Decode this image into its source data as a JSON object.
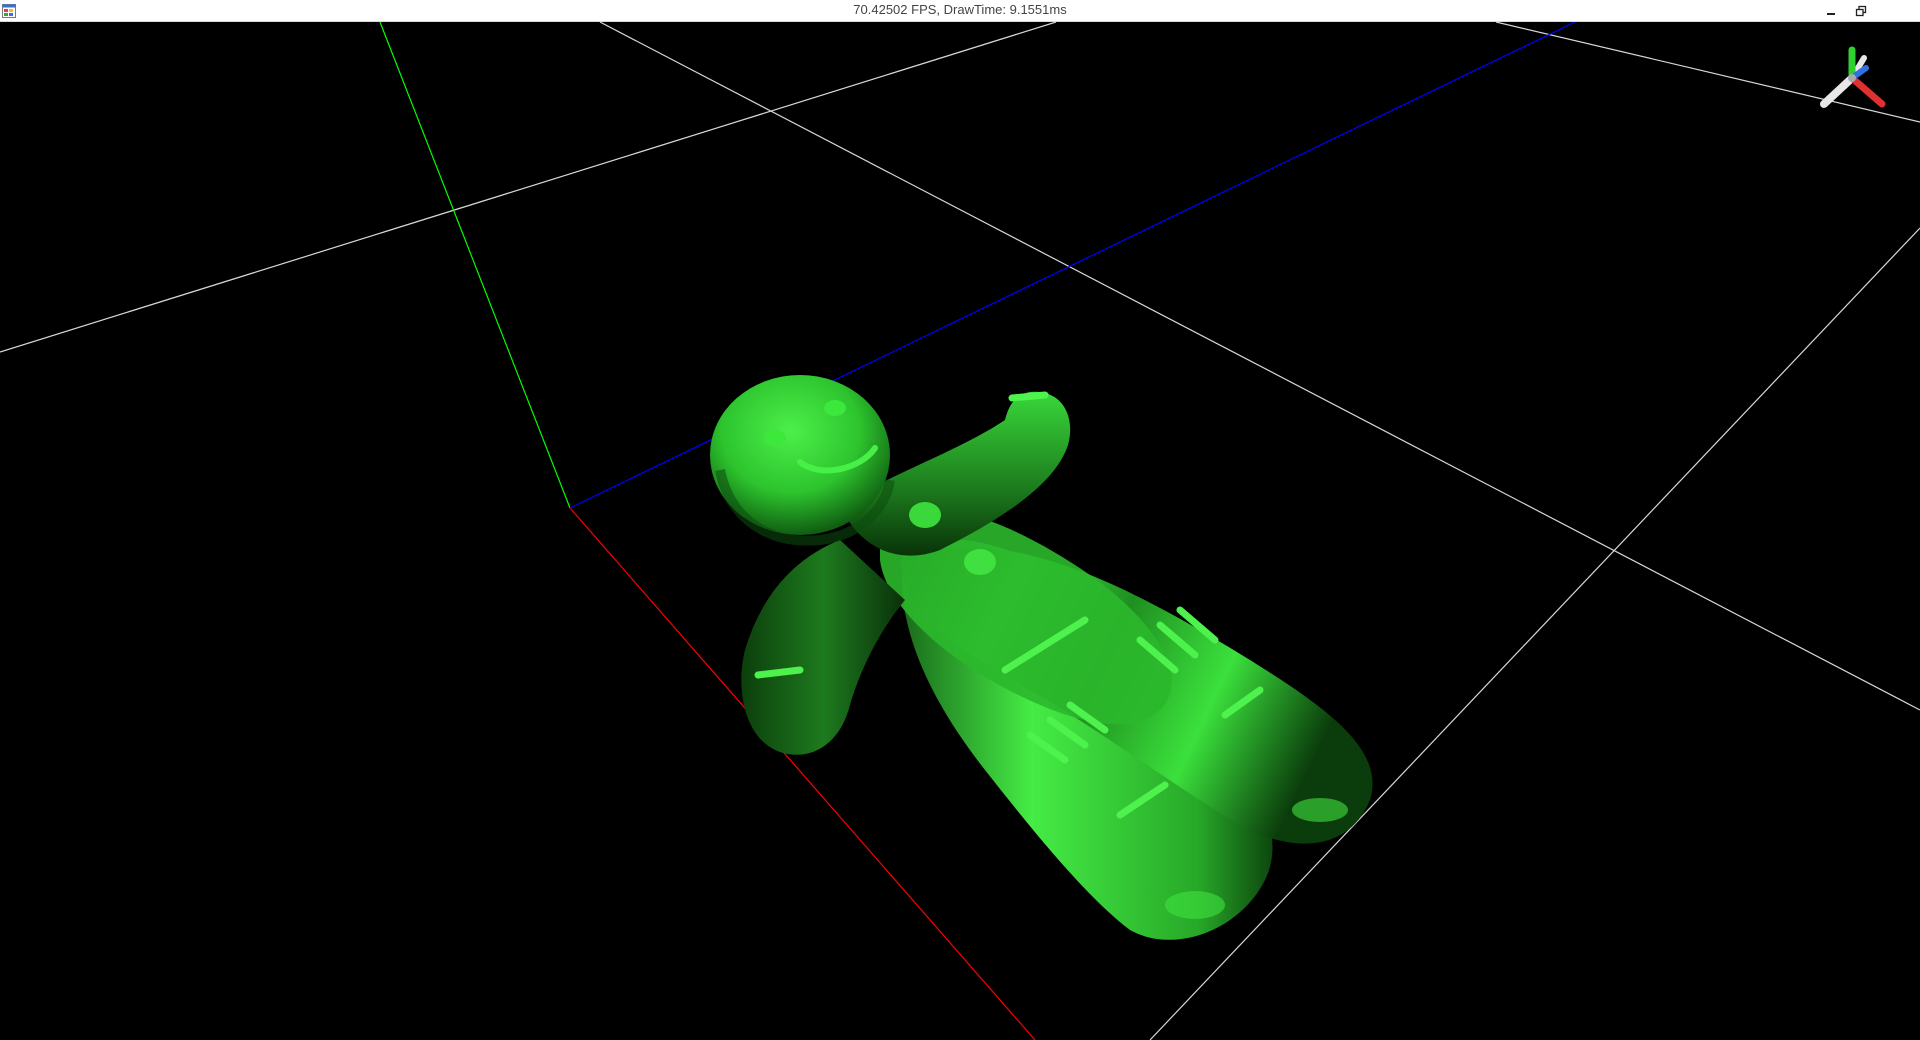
{
  "window": {
    "title": "70.42502 FPS, DrawTime: 9.1551ms",
    "icons": {
      "app": "app-window-icon",
      "minimize": "minimize-icon",
      "restore": "restore-icon"
    }
  },
  "viewport": {
    "background": "#000000",
    "grid_color": "#ffffff",
    "axis_colors": {
      "x": "#ff0000",
      "y": "#00ff00",
      "z": "#0000ff"
    },
    "model": {
      "name": "gingerbread-man",
      "color": "#39e03a"
    },
    "orientation_gizmo": "axis-gizmo-icon"
  }
}
